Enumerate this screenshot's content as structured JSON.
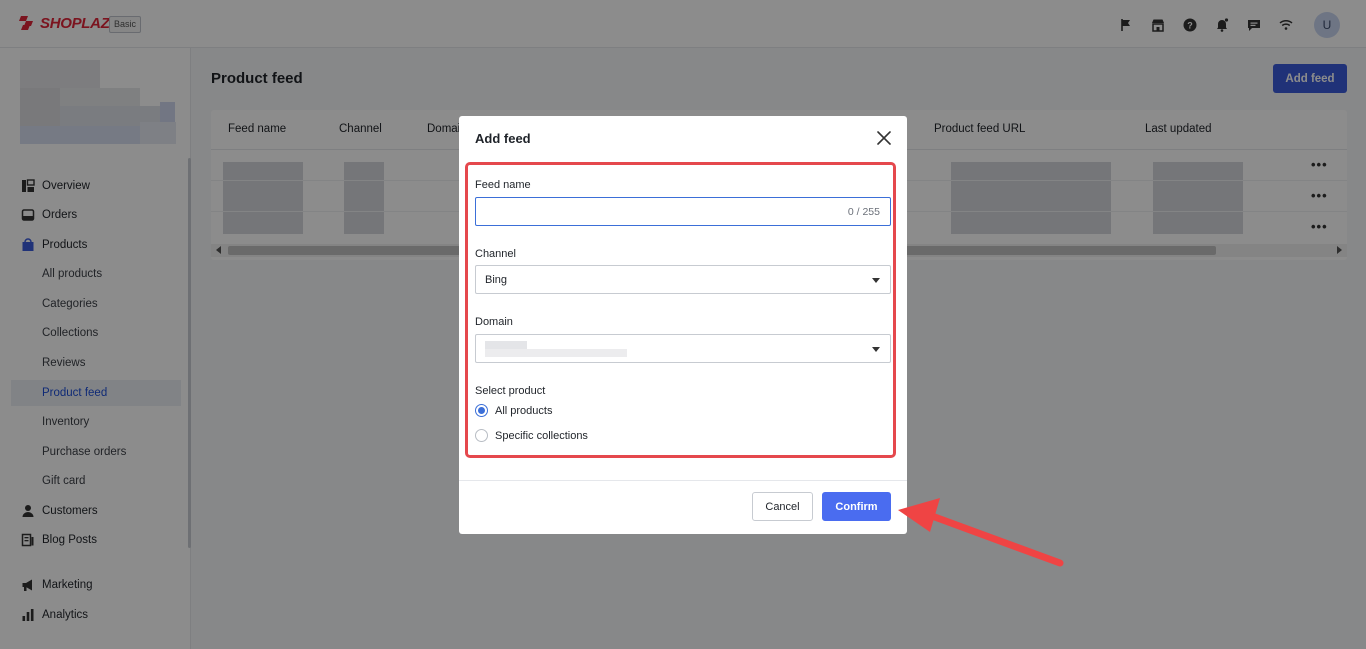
{
  "brand": {
    "name": "SHOPLAZZA",
    "plan": "Basic"
  },
  "topbar": {
    "icons": [
      "flag-icon",
      "store-icon",
      "help-icon",
      "bell-icon",
      "chat-icon",
      "wifi-icon"
    ],
    "avatar_initial": "U"
  },
  "sidebar": {
    "items": [
      {
        "label": "Overview",
        "icon": "overview-icon"
      },
      {
        "label": "Orders",
        "icon": "orders-icon"
      },
      {
        "label": "Products",
        "icon": "products-icon"
      },
      {
        "label": "All products"
      },
      {
        "label": "Categories"
      },
      {
        "label": "Collections"
      },
      {
        "label": "Reviews"
      },
      {
        "label": "Product feed",
        "active": true
      },
      {
        "label": "Inventory"
      },
      {
        "label": "Purchase orders"
      },
      {
        "label": "Gift card"
      },
      {
        "label": "Customers",
        "icon": "customers-icon"
      },
      {
        "label": "Blog Posts",
        "icon": "blog-icon"
      },
      {
        "label": "Marketing",
        "icon": "marketing-icon"
      },
      {
        "label": "Analytics",
        "icon": "analytics-icon"
      }
    ]
  },
  "main": {
    "title": "Product feed",
    "add_button": "Add feed",
    "table": {
      "columns": [
        "Feed name",
        "Channel",
        "Domain",
        "Product feed URL",
        "Last updated"
      ],
      "row_action": "•••"
    }
  },
  "modal": {
    "title": "Add feed",
    "feed_name": {
      "label": "Feed name",
      "value": "",
      "counter": "0 / 255"
    },
    "channel": {
      "label": "Channel",
      "value": "Bing"
    },
    "domain": {
      "label": "Domain",
      "value": ""
    },
    "select_product": {
      "label": "Select product",
      "options": [
        {
          "label": "All products",
          "checked": true
        },
        {
          "label": "Specific collections",
          "checked": false
        }
      ]
    },
    "cancel": "Cancel",
    "confirm": "Confirm"
  },
  "colors": {
    "accent": "#3b5bdb",
    "confirm": "#4a6cf0",
    "highlight": "#e5484d",
    "brand": "#e0263a"
  }
}
